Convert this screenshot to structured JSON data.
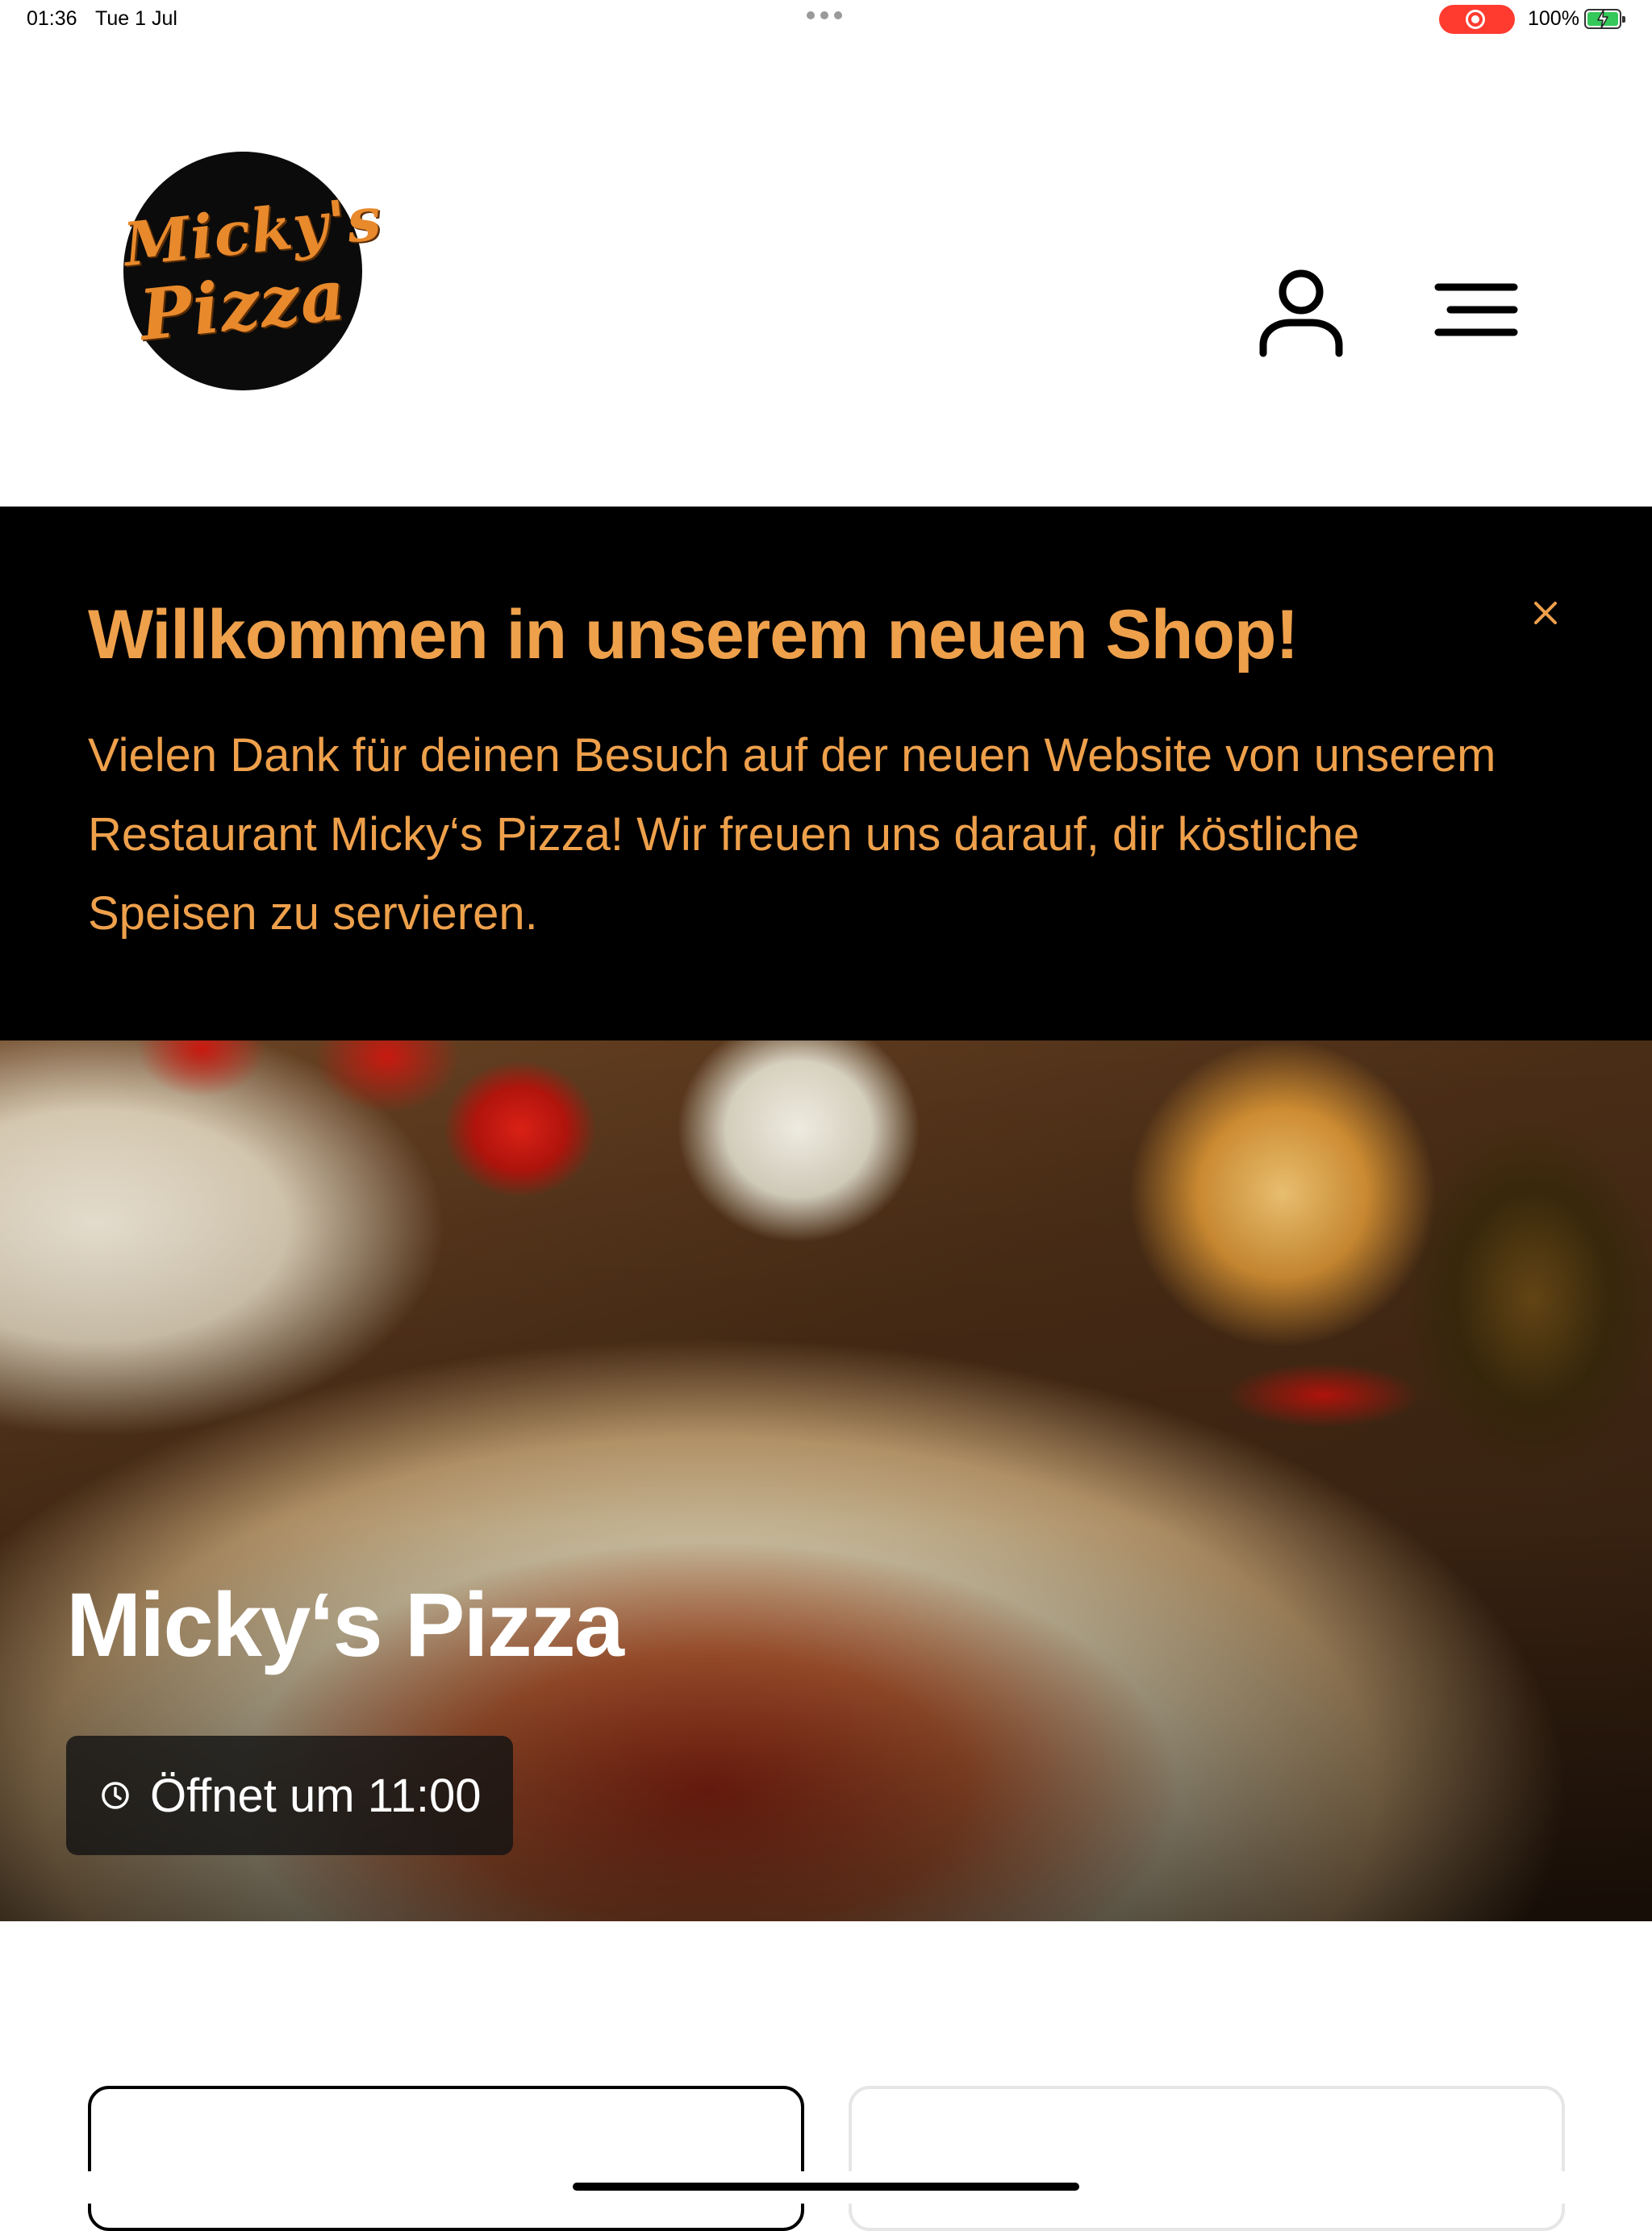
{
  "status_bar": {
    "time": "01:36",
    "date": "Tue 1 Jul",
    "battery": "100%",
    "recording_color": "#ff3b30",
    "battery_color": "#34c759"
  },
  "header": {
    "logo": {
      "line1": "Micky's",
      "line2": "Pizza",
      "icon": "logo"
    },
    "account_icon": "user-icon",
    "menu_icon": "hamburger-menu-icon"
  },
  "banner": {
    "title": "Willkommen in unserem neuen Shop!",
    "text": "Vielen Dank für deinen Besuch auf der neuen Website von unserem Restaurant Micky‘s Pizza! Wir freuen uns darauf, dir köstliche Speisen zu servieren.",
    "close_icon": "close-icon",
    "accent_color": "#eea04b",
    "background_color": "#000000"
  },
  "hero": {
    "title": "Micky‘s Pizza",
    "hours_label": "Öffnet um 11:00",
    "hours_icon": "clock-icon"
  }
}
